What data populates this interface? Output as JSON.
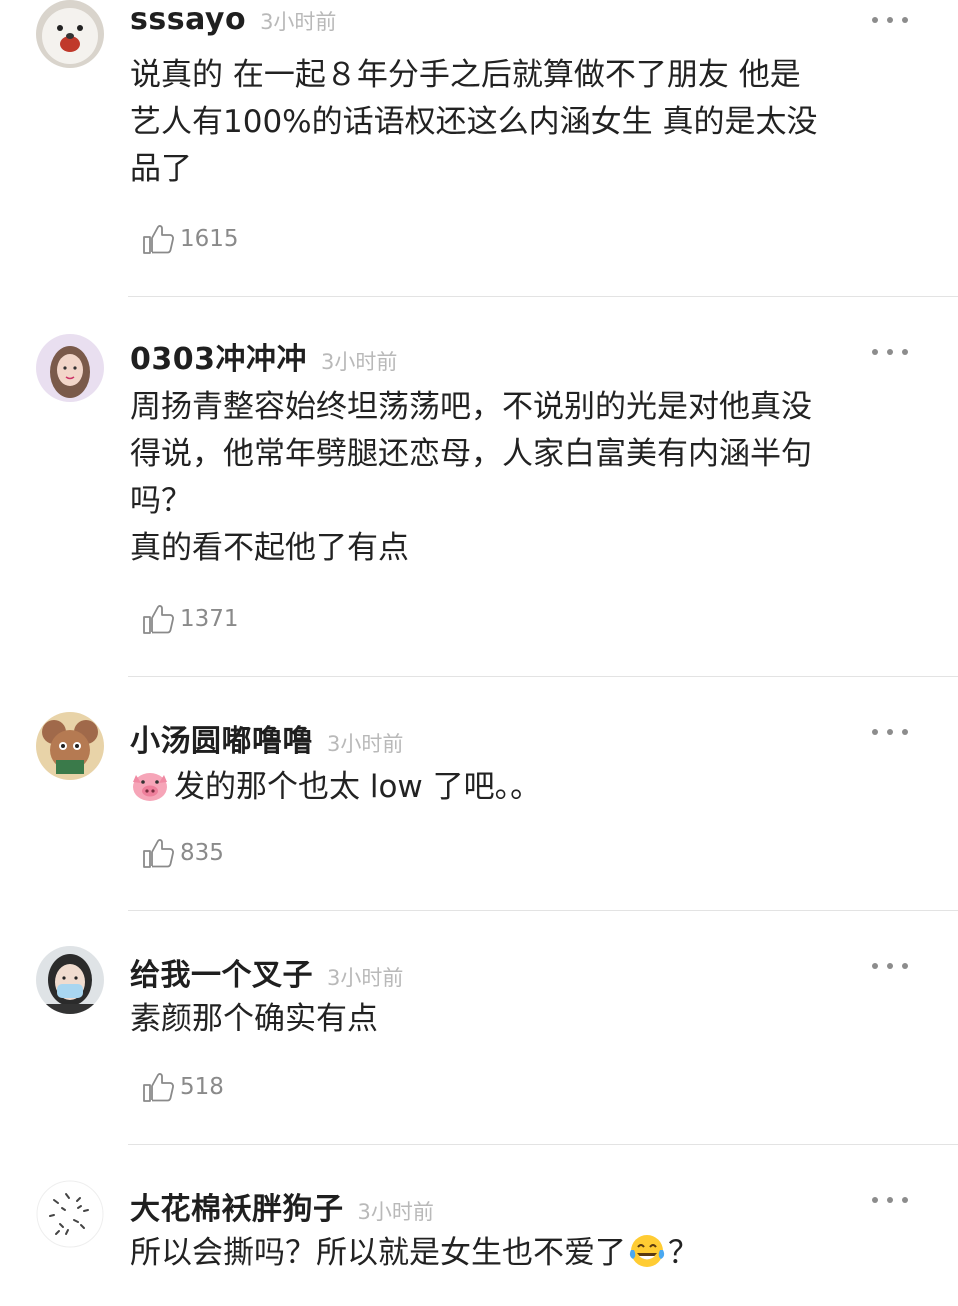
{
  "comments": [
    {
      "username": "sssayo",
      "time": "3小时前",
      "lines": [
        "说真的 在一起８年分手之后就算做不了朋友 他是",
        "艺人有100%的话语权还这么内涵女生 真的是太没",
        "品了"
      ],
      "likes": "1615",
      "avatar": "white-dog-avatar"
    },
    {
      "username": "0303冲冲冲",
      "time": "3小时前",
      "lines": [
        "周扬青整容始终坦荡荡吧，不说别的光是对他真没",
        "得说，他常年劈腿还恋母，人家白富美有内涵半句",
        "吗？",
        "真的看不起他了有点"
      ],
      "likes": "1371",
      "avatar": "girl-photo-avatar"
    },
    {
      "username": "小汤圆嘟噜噜",
      "time": "3小时前",
      "lines": [
        "发的那个也太 low 了吧。。"
      ],
      "lead_emoji": "pig-face-emoji",
      "likes": "835",
      "avatar": "cartoon-mouse-avatar"
    },
    {
      "username": "给我一个叉子",
      "time": "3小时前",
      "lines": [
        "素颜那个确实有点"
      ],
      "likes": "518",
      "avatar": "masked-person-avatar"
    },
    {
      "username": "大花棉袄胖狗子",
      "time": "3小时前",
      "lines": [
        "所以会撕吗？所以就是女生也不爱了",
        "？"
      ],
      "tail_emoji": "tears-of-joy-emoji",
      "avatar": "floral-pattern-avatar"
    }
  ],
  "colors": {
    "username": "#1f1f1f",
    "time": "#b9b9b9",
    "text": "#222222",
    "like_count": "#8a8a8a",
    "divider": "#e3e3e3"
  }
}
